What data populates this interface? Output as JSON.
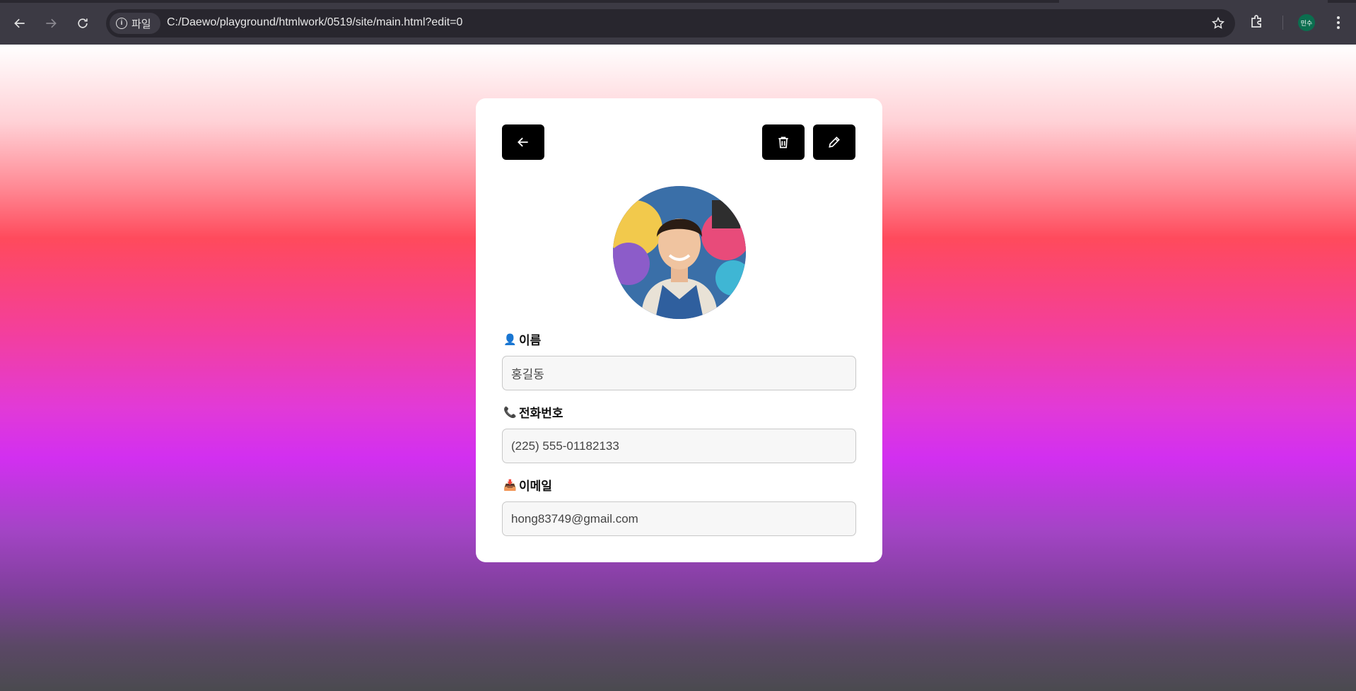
{
  "browser": {
    "site_chip_label": "파일",
    "url": "C:/Daewo/playground/htmlwork/0519/site/main.html?edit=0",
    "profile_initials": "민수"
  },
  "card": {
    "name": {
      "label": "이름",
      "icon": "user-icon",
      "value": "홍길동"
    },
    "phone": {
      "label": "전화번호",
      "icon": "telephone-icon",
      "value": "(225) 555-01182133"
    },
    "email": {
      "label": "이메일",
      "icon": "inbox-tray-icon",
      "value": "hong83749@gmail.com"
    },
    "avatar_alt": "profile-photo"
  },
  "colors": {
    "button_bg": "#000000",
    "card_bg": "#ffffff",
    "gradient_top": "#ffffff",
    "gradient_red": "#ff4a5c",
    "gradient_magenta": "#d22ff0",
    "gradient_bottom": "#4a4a4f"
  }
}
